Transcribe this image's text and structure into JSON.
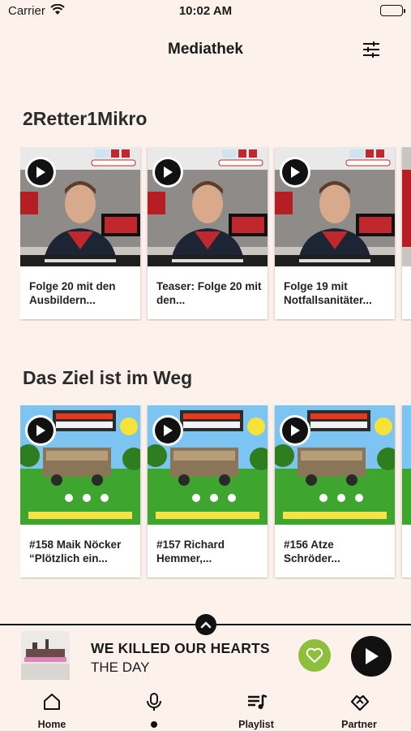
{
  "status_bar": {
    "carrier": "Carrier",
    "time": "10:02 AM"
  },
  "header": {
    "title": "Mediathek",
    "filter_icon": "sliders-icon"
  },
  "sections": [
    {
      "title": "2Retter1Mikro",
      "episodes": [
        {
          "label": "Folge 20 mit den Ausbildern..."
        },
        {
          "label": "Teaser: Folge 20 mit den..."
        },
        {
          "label": "Folge 19 mit Notfallsanitäter..."
        }
      ]
    },
    {
      "title": "Das Ziel ist im Weg",
      "episodes": [
        {
          "label": "#158 Maik Nöcker “Plötzlich ein..."
        },
        {
          "label": "#157 Richard Hemmer,..."
        },
        {
          "label": "#156 Atze Schröder..."
        }
      ]
    }
  ],
  "player": {
    "title": "WE KILLED OUR HEARTS",
    "artist": "THE DAY",
    "like_color": "#8DBE3C",
    "expand_icon": "chevron-up-icon",
    "play_icon": "play-icon"
  },
  "tabs": [
    {
      "label": "Home",
      "icon": "home-icon"
    },
    {
      "label": "",
      "icon": "microphone-icon",
      "active_dot": true
    },
    {
      "label": "Playlist",
      "icon": "playlist-icon"
    },
    {
      "label": "Partner",
      "icon": "handshake-icon"
    }
  ],
  "colors": {
    "background": "#FDF1EC",
    "accent_green": "#8DBE3C",
    "dark": "#111111"
  }
}
